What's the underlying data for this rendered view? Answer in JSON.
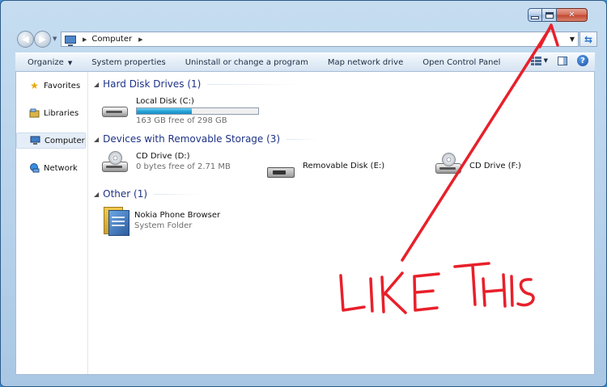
{
  "window": {
    "caption_buttons": {
      "minimize": "minimize",
      "maximize": "maximize",
      "close": "close"
    }
  },
  "address_bar": {
    "crumbs": [
      "Computer"
    ],
    "icon": "computer-icon"
  },
  "toolbar": {
    "organize_label": "Organize",
    "system_properties_label": "System properties",
    "uninstall_label": "Uninstall or change a program",
    "map_drive_label": "Map network drive",
    "control_panel_label": "Open Control Panel"
  },
  "nav_pane": {
    "items": [
      {
        "label": "Favorites",
        "icon": "star-icon"
      },
      {
        "label": "Libraries",
        "icon": "libraries-icon"
      },
      {
        "label": "Computer",
        "icon": "computer-icon",
        "selected": true
      },
      {
        "label": "Network",
        "icon": "network-icon"
      }
    ]
  },
  "groups": {
    "hdd": {
      "title": "Hard Disk Drives (1)",
      "items": [
        {
          "name": "Local Disk (C:)",
          "detail": "163 GB free of 298 GB",
          "used_fraction": 0.45,
          "icon": "hard-disk-icon"
        }
      ]
    },
    "removable": {
      "title": "Devices with Removable Storage (3)",
      "items": [
        {
          "name": "CD Drive (D:)",
          "detail": "0 bytes free of 2.71 MB",
          "icon": "cd-drive-icon"
        },
        {
          "name": "Removable Disk (E:)",
          "icon": "removable-disk-icon"
        },
        {
          "name": "CD Drive (F:)",
          "icon": "cd-drive-icon"
        }
      ]
    },
    "other": {
      "title": "Other (1)",
      "items": [
        {
          "name": "Nokia Phone Browser",
          "detail": "System Folder",
          "icon": "nokia-folder-icon"
        }
      ]
    }
  },
  "annotation": {
    "text": "LIKE THIS",
    "color": "#e8202a"
  },
  "colors": {
    "group_header": "#1e3287",
    "accent_bar": "#27a4d9",
    "close_button": "#c44a34"
  }
}
